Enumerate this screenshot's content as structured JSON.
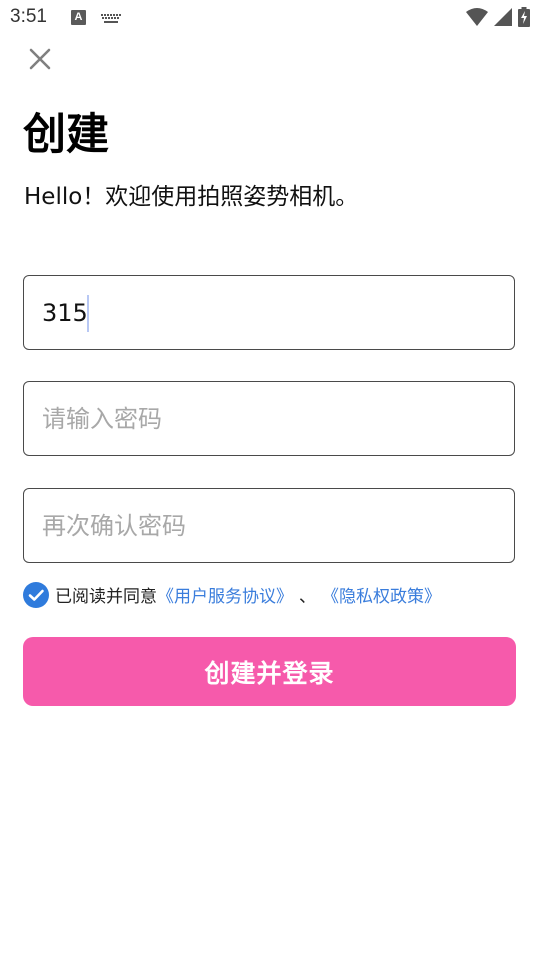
{
  "status_bar": {
    "time": "3:51",
    "a_icon_text": "A",
    "icons": [
      "a-notification-icon",
      "keyboard-icon",
      "wifi-icon",
      "signal-icon",
      "battery-charging-icon"
    ]
  },
  "header": {
    "close_icon": "close-icon",
    "title": "创建",
    "subtitle": "Hello！欢迎使用拍照姿势相机。"
  },
  "form": {
    "account": {
      "value": "315",
      "placeholder": ""
    },
    "password": {
      "value": "",
      "placeholder": "请输入密码"
    },
    "confirm_password": {
      "value": "",
      "placeholder": "再次确认密码"
    }
  },
  "agreement": {
    "checked": true,
    "prefix": "已阅读并同意",
    "user_agreement": "《用户服务协议》",
    "separator": "、",
    "privacy_policy": "《隐私权政策》"
  },
  "submit": {
    "label": "创建并登录"
  },
  "colors": {
    "primary_button": "#f65aab",
    "link": "#3a7ddc",
    "checkbox": "#2f7bdc",
    "caret": "#b8c8f4"
  }
}
